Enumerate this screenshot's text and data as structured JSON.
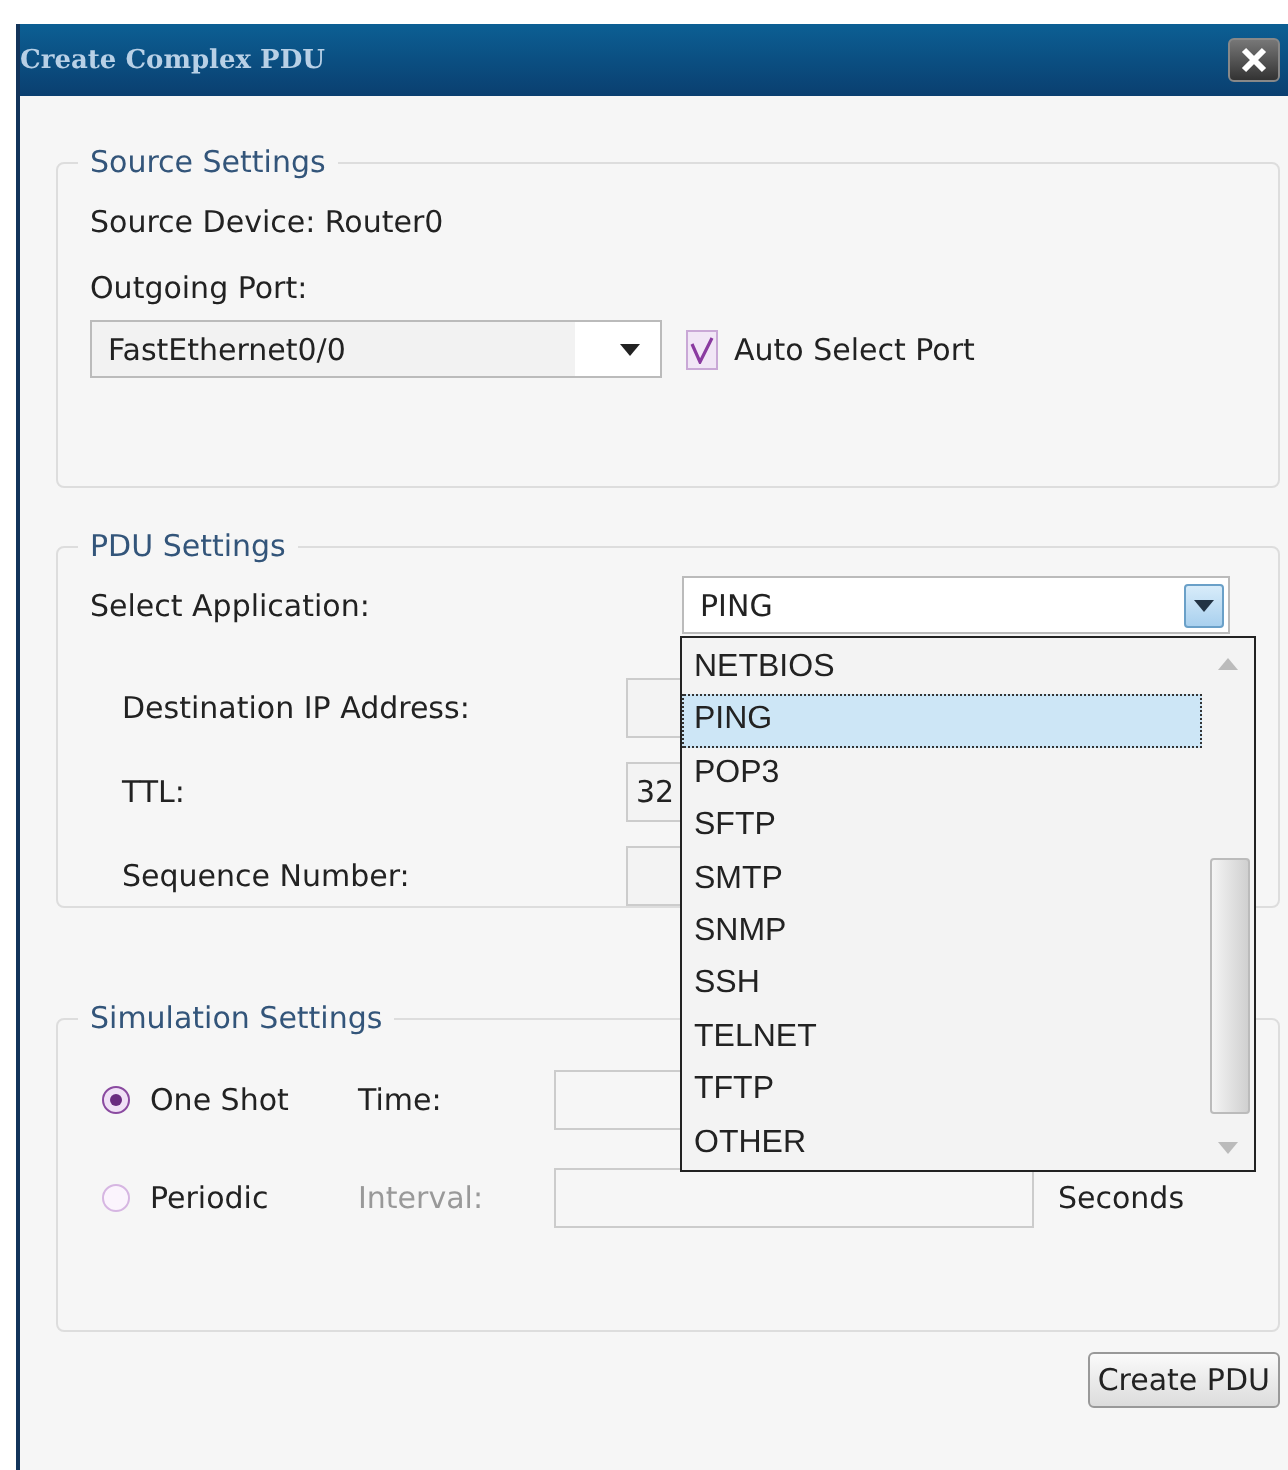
{
  "window": {
    "title": "Create Complex PDU"
  },
  "source_settings": {
    "title": "Source Settings",
    "source_device": "Source Device: Router0",
    "outgoing_port_label": "Outgoing Port:",
    "port": "FastEthernet0/0",
    "auto_select": {
      "label": "Auto Select Port",
      "checked": true
    }
  },
  "pdu_settings": {
    "title": "PDU Settings",
    "application_label": "Select Application:",
    "application": "PING",
    "dropdown": {
      "expanded": true,
      "options": [
        {
          "label": "NETBIOS",
          "selected": false
        },
        {
          "label": "PING",
          "selected": true
        },
        {
          "label": "POP3",
          "selected": false
        },
        {
          "label": "SFTP",
          "selected": false
        },
        {
          "label": "SMTP",
          "selected": false
        },
        {
          "label": "SNMP",
          "selected": false
        },
        {
          "label": "SSH",
          "selected": false
        },
        {
          "label": "TELNET",
          "selected": false
        },
        {
          "label": "TFTP",
          "selected": false
        },
        {
          "label": "OTHER",
          "selected": false
        }
      ]
    },
    "fields": [
      {
        "label": "Destination IP Address:"
      },
      {
        "label": "TTL:",
        "value": "32"
      },
      {
        "label": "Sequence Number:"
      }
    ]
  },
  "simulation_settings": {
    "title": "Simulation Settings",
    "modes": [
      {
        "label": "One Shot",
        "selected": true,
        "field_label": "Time:",
        "field_disabled": false
      },
      {
        "label": "Periodic",
        "selected": false,
        "field_label": "Interval:",
        "field_disabled": true,
        "unit": "Seconds"
      }
    ]
  },
  "buttons": [
    {
      "label": "Create PDU"
    }
  ]
}
